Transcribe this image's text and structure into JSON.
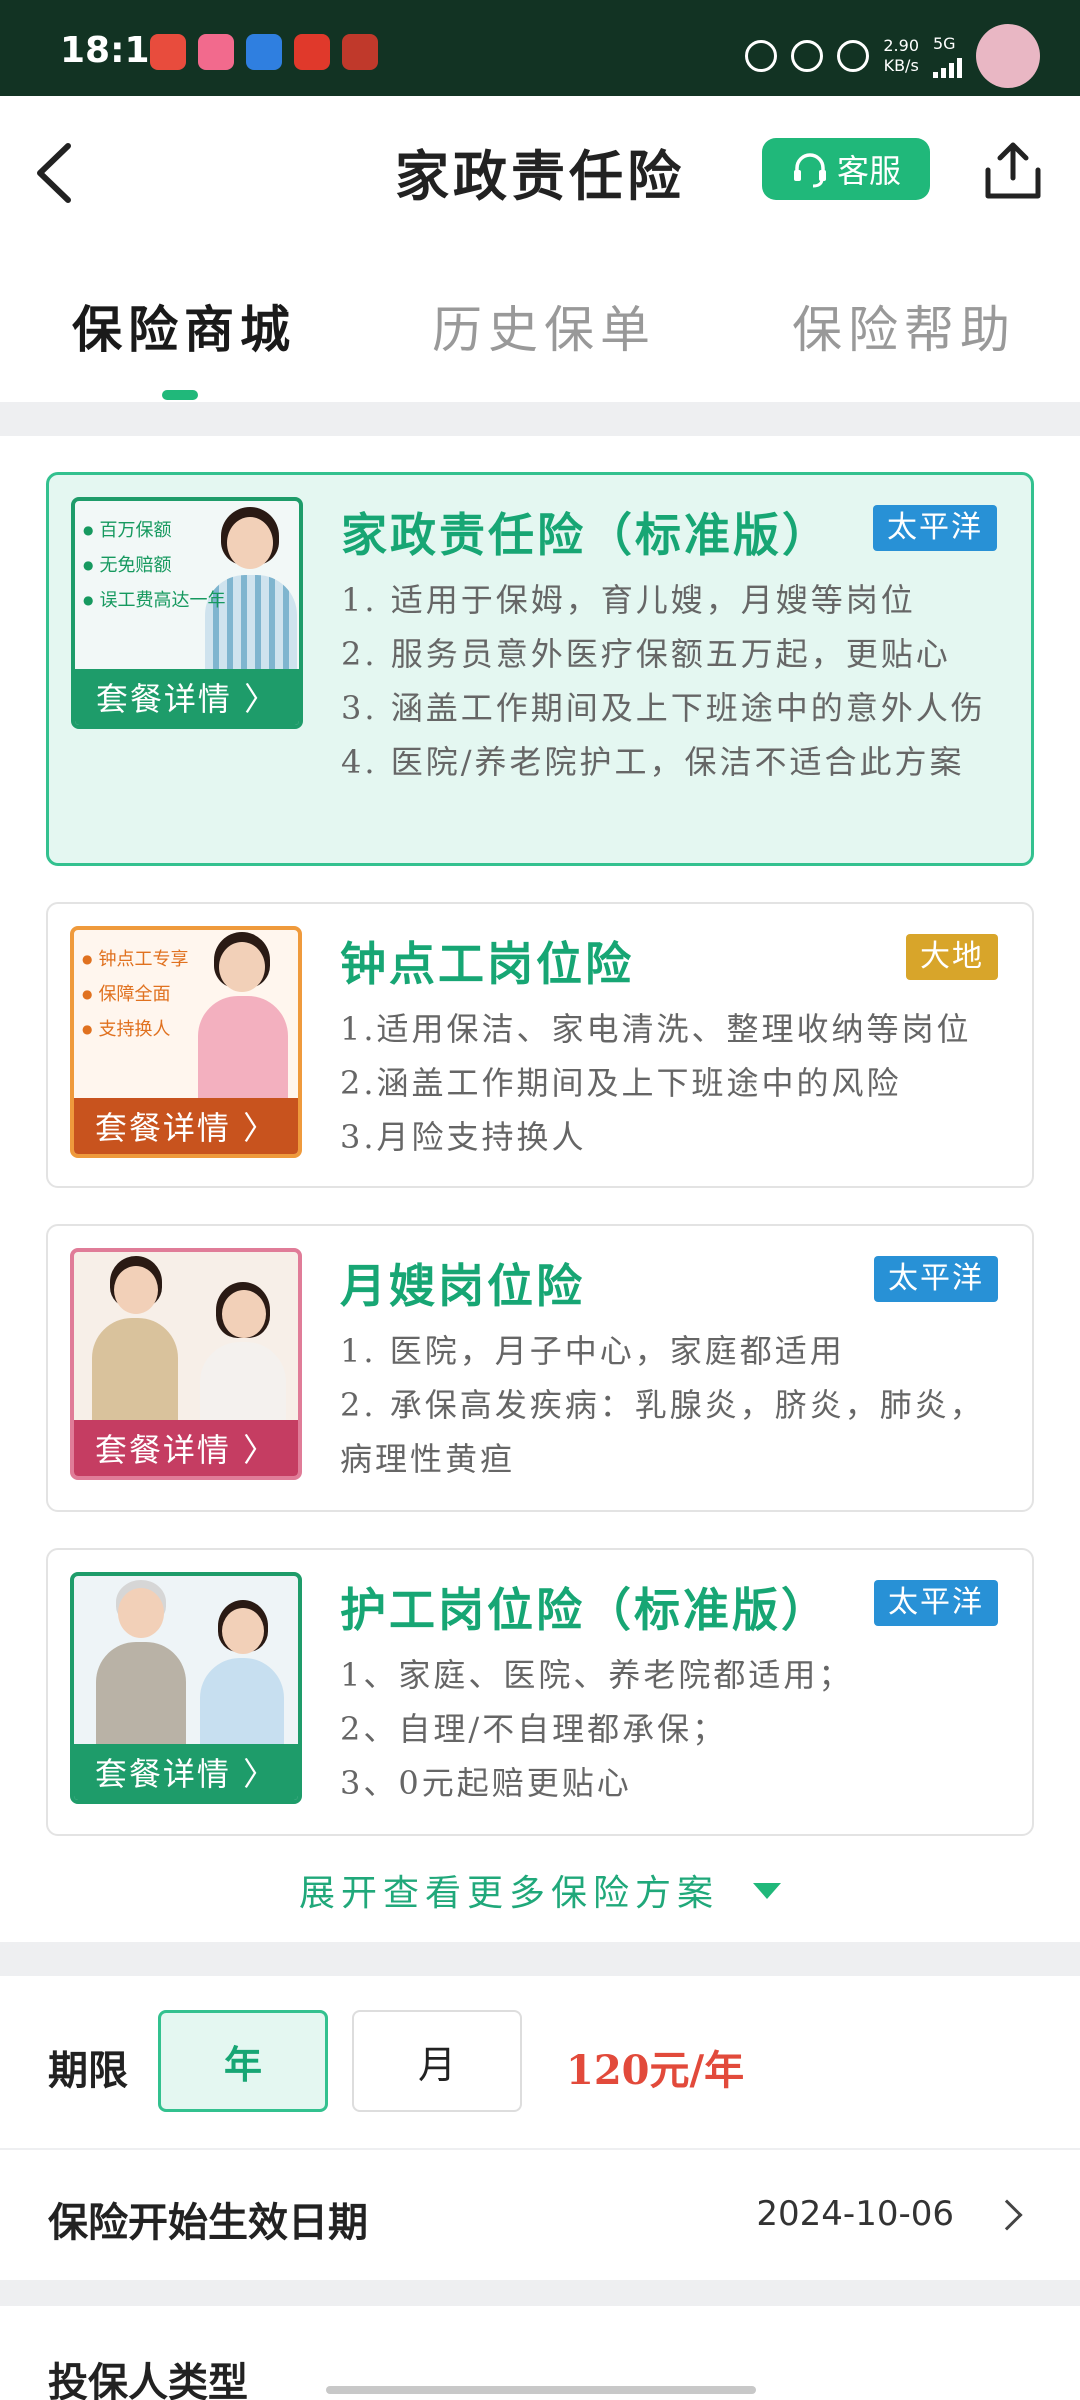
{
  "status_bar": {
    "time": "18:18",
    "speed_value": "2.90",
    "speed_unit": "KB/s",
    "network": "5G",
    "app_icon_colors": [
      "#e84c3d",
      "#f26a8d",
      "#2f7fe0",
      "#e0392b",
      "#c0392b"
    ]
  },
  "header": {
    "title": "家政责任险",
    "service_label": "客服",
    "back_icon": "chevron-left-icon",
    "share_icon": "share-icon"
  },
  "tabs": [
    {
      "label": "保险商城",
      "active": true
    },
    {
      "label": "历史保单",
      "active": false
    },
    {
      "label": "保险帮助",
      "active": false
    }
  ],
  "products": [
    {
      "title": "家政责任险（标准版）",
      "insurer": "太平洋",
      "insurer_color": "#2891d6",
      "thumb_features": [
        "百万保额",
        "无免赔额",
        "误工费高达一年"
      ],
      "thumb_button": "套餐详情 〉",
      "thumb_color": "#1e9c6a",
      "selected": true,
      "lines": [
        "1. 适用于保姆，育儿嫂，月嫂等岗位",
        "2. 服务员意外医疗保额五万起，更贴心",
        "3. 涵盖工作期间及上下班途中的意外人伤",
        "4. 医院/养老院护工，保洁不适合此方案"
      ]
    },
    {
      "title": "钟点工岗位险",
      "insurer": "大地",
      "insurer_color": "#d8a52a",
      "thumb_features": [
        "钟点工专享",
        "保障全面",
        "支持换人"
      ],
      "thumb_button": "套餐详情 〉",
      "thumb_color": "#c8531e",
      "selected": false,
      "lines": [
        "1.适用保洁、家电清洗、整理收纳等岗位",
        "2.涵盖工作期间及上下班途中的风险",
        "3.月险支持换人"
      ]
    },
    {
      "title": "月嫂岗位险",
      "insurer": "太平洋",
      "insurer_color": "#2891d6",
      "thumb_features": [],
      "thumb_button": "套餐详情 〉",
      "thumb_color": "#c53d62",
      "selected": false,
      "lines": [
        "1. 医院，月子中心，家庭都适用",
        "2. 承保高发疾病：乳腺炎，脐炎，肺炎，病理性黄疸"
      ]
    },
    {
      "title": "护工岗位险（标准版）",
      "insurer": "太平洋",
      "insurer_color": "#2891d6",
      "thumb_features": [],
      "thumb_button": "套餐详情 〉",
      "thumb_color": "#1e9c6a",
      "selected": false,
      "lines": [
        "1、家庭、医院、养老院都适用；",
        "2、自理/不自理都承保；",
        "3、0元起赔更贴心"
      ]
    }
  ],
  "expand_label": "展开查看更多保险方案",
  "period": {
    "label": "期限",
    "options": [
      {
        "label": "年",
        "selected": true
      },
      {
        "label": "月",
        "selected": false
      }
    ],
    "price": "120元/年"
  },
  "start_date": {
    "label": "保险开始生效日期",
    "value": "2024-10-06"
  },
  "insurer_type": {
    "label": "投保人类型"
  },
  "colors": {
    "accent": "#20b87a",
    "accent_text": "#17a674",
    "price": "#e24a3b",
    "status_bar": "#123323"
  }
}
